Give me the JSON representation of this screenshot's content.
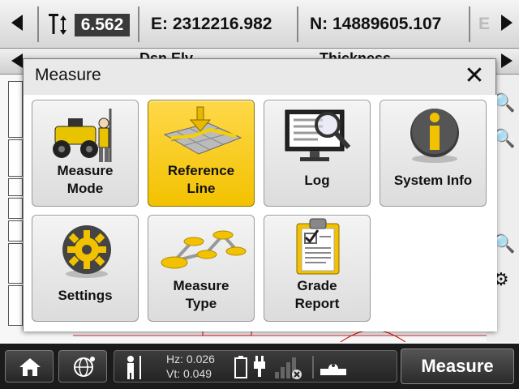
{
  "topbar": {
    "height_value": "6.562",
    "easting": "E: 2312216.982",
    "northing": "N: 14889605.107",
    "overflow": "E"
  },
  "bar2": {
    "col1": "Dsn Elv",
    "col2": "Thickness"
  },
  "dialog": {
    "title": "Measure",
    "close": "✕",
    "tiles": [
      {
        "label": "Measure\nMode",
        "active": false
      },
      {
        "label": "Reference\nLine",
        "active": true
      },
      {
        "label": "Log",
        "active": false
      },
      {
        "label": "System Info",
        "active": false
      },
      {
        "label": "Settings",
        "active": false
      },
      {
        "label": "Measure\nType",
        "active": false
      },
      {
        "label": "Grade\nReport",
        "active": false
      }
    ]
  },
  "status": {
    "hz": "Hz: 0.026",
    "vt": "Vt: 0.049"
  },
  "bottom": {
    "measure_label": "Measure"
  },
  "colors": {
    "accent_yellow": "#f2c200",
    "dark_bar": "#1b1b1b"
  }
}
